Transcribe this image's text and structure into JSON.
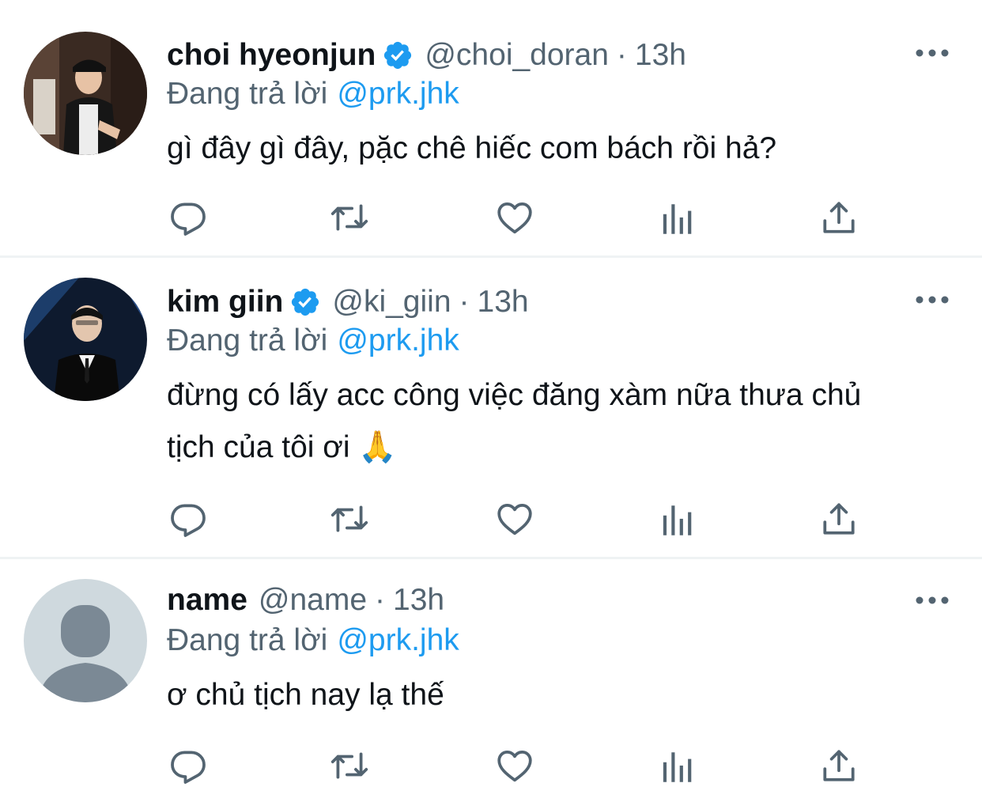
{
  "replies": [
    {
      "display_name": "choi hyeonjun",
      "verified": true,
      "handle": "@choi_doran",
      "separator": "·",
      "time": "13h",
      "replying_prefix": "Đang trả lời",
      "replying_to": "@prk.jhk",
      "text": "gì đây gì đây, pặc chê hiếc com bách rồi hả?"
    },
    {
      "display_name": "kim giin",
      "verified": true,
      "handle": "@ki_giin",
      "separator": "·",
      "time": "13h",
      "replying_prefix": "Đang trả lời",
      "replying_to": "@prk.jhk",
      "text": "đừng có lấy acc công việc đăng xàm nữa thưa chủ tịch của tôi ơi 🙏"
    },
    {
      "display_name": "name",
      "verified": false,
      "handle": "@name",
      "separator": "·",
      "time": "13h",
      "replying_prefix": "Đang trả lời",
      "replying_to": "@prk.jhk",
      "text": "ơ chủ tịch nay lạ thế"
    }
  ],
  "icons": {
    "verified": "verified-badge-icon",
    "more": "more-options-icon",
    "reply": "reply-icon",
    "retweet": "retweet-icon",
    "like": "like-icon",
    "views": "views-icon",
    "share": "share-icon"
  },
  "colors": {
    "accent": "#1d9bf0",
    "secondary_text": "#536471",
    "primary_text": "#0f1419",
    "divider": "#eff3f4"
  }
}
